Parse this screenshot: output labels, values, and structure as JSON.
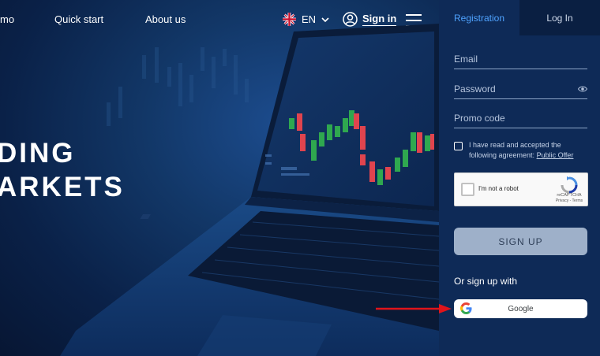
{
  "nav": {
    "demo_label": "mo",
    "quick_start_label": "Quick start",
    "about_label": "About us",
    "language": "EN",
    "sign_in_label": "Sign in"
  },
  "hero": {
    "headline_line1": "DING",
    "headline_line2": "ARKETS"
  },
  "panel": {
    "tabs": [
      "Registration",
      "Log In"
    ],
    "active_tab": "Registration",
    "email_placeholder": "Email",
    "password_placeholder": "Password",
    "promo_placeholder": "Promo code",
    "agreement_text": "I have read and accepted the following agreement:",
    "agreement_link": "Public Offer",
    "captcha_label": "I'm not a robot",
    "captcha_brand": "reCAPTCHA",
    "captcha_terms": "Privacy - Terms",
    "signup_label": "SIGN UP",
    "or_label": "Or sign up with",
    "google_label": "Google"
  },
  "colors": {
    "accent": "#4fa3ff",
    "panel_bg": "#0e2a57",
    "signup_button": "#9eb0c9",
    "arrow": "#e0141b"
  }
}
